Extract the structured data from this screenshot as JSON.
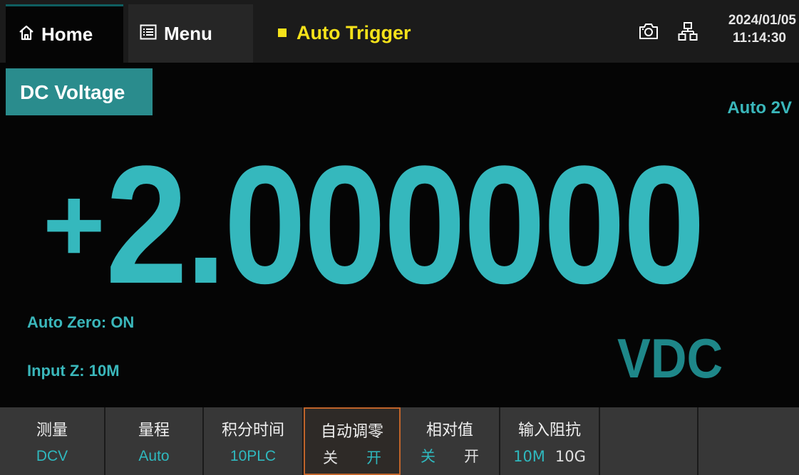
{
  "topbar": {
    "home_label": "Home",
    "menu_label": "Menu",
    "trigger_label": "Auto Trigger",
    "date": "2024/01/05",
    "time": "11:14:30"
  },
  "main": {
    "function_label": "DC Voltage",
    "range_label": "Auto 2V",
    "reading_sign": "+",
    "reading_digits": "2.000000",
    "auto_zero_status": "Auto Zero: ON",
    "input_z_status": "Input Z: 10M",
    "unit": "VDC"
  },
  "softkeys": [
    {
      "title": "测量",
      "value": "DCV"
    },
    {
      "title": "量程",
      "value": "Auto"
    },
    {
      "title": "积分时间",
      "value": "10PLC"
    },
    {
      "title": "自动调零",
      "options": [
        "关",
        "开"
      ],
      "selected": "开"
    },
    {
      "title": "相对值",
      "options": [
        "关",
        "开"
      ],
      "selected": "关"
    },
    {
      "title": "输入阻抗",
      "options": [
        "10M",
        "10G"
      ],
      "selected": "10M"
    },
    {
      "title": ""
    },
    {
      "title": ""
    }
  ],
  "colors": {
    "accent": "#35b8bd",
    "trigger": "#f5e21a",
    "active_border": "#c0642a",
    "function_bg": "#2a8c8d"
  },
  "icons": [
    "home-icon",
    "menu-icon",
    "camera-icon",
    "network-icon"
  ]
}
